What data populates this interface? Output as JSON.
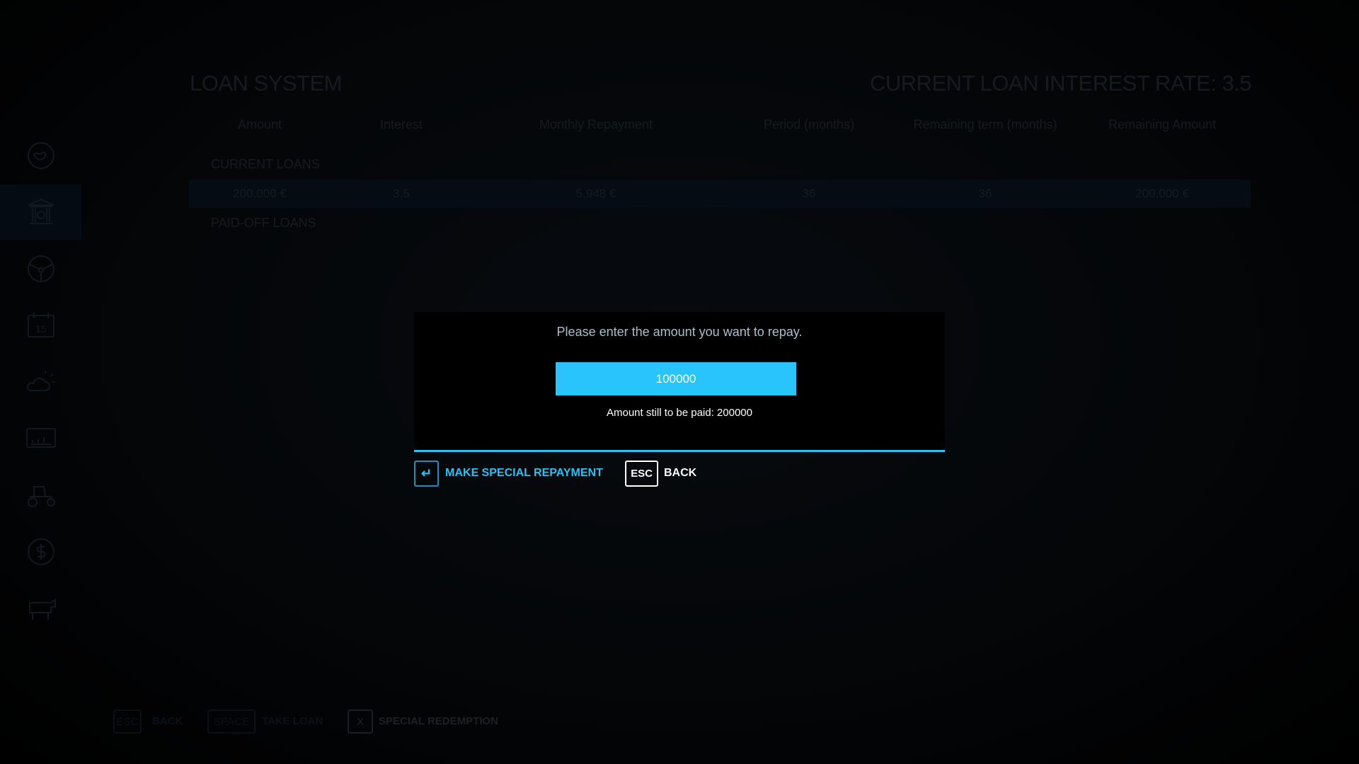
{
  "header": {
    "title": "LOAN SYSTEM",
    "interest_rate": "CURRENT LOAN INTEREST RATE: 3.5"
  },
  "table": {
    "columns": [
      "Amount",
      "Interest",
      "Monthly Repayment",
      "Period (months)",
      "Remaining term (months)",
      "Remaining Amount"
    ],
    "current_label": "CURRENT LOANS",
    "current_loans": [
      [
        "200,000 €",
        "3.5",
        "5,948 €",
        "36",
        "36",
        "200,000 €"
      ]
    ],
    "paid_off_label": "PAID-OFF LOANS"
  },
  "sidebar": {
    "items": [
      "map-icon",
      "bank-icon",
      "steering-wheel-icon",
      "calendar-icon",
      "weather-icon",
      "statistics-icon",
      "tractor-icon",
      "finance-icon",
      "animals-icon"
    ],
    "calendar_day": "15",
    "active": 1
  },
  "dialog": {
    "prompt": "Please enter the amount you want to repay.",
    "input_value": "100000",
    "remaining_text": "Amount still to be paid: 200000",
    "confirm_key": "↵",
    "confirm_label": "MAKE SPECIAL REPAYMENT",
    "back_key": "ESC",
    "back_label": "BACK"
  },
  "footer": [
    {
      "key": "ESC",
      "label": "BACK"
    },
    {
      "key": "SPACE",
      "label": "TAKE LOAN"
    },
    {
      "key": "X",
      "label": "SPECIAL REDEMPTION"
    }
  ],
  "colors": {
    "accent": "#29c4fc",
    "dim_text": "#161b21"
  }
}
